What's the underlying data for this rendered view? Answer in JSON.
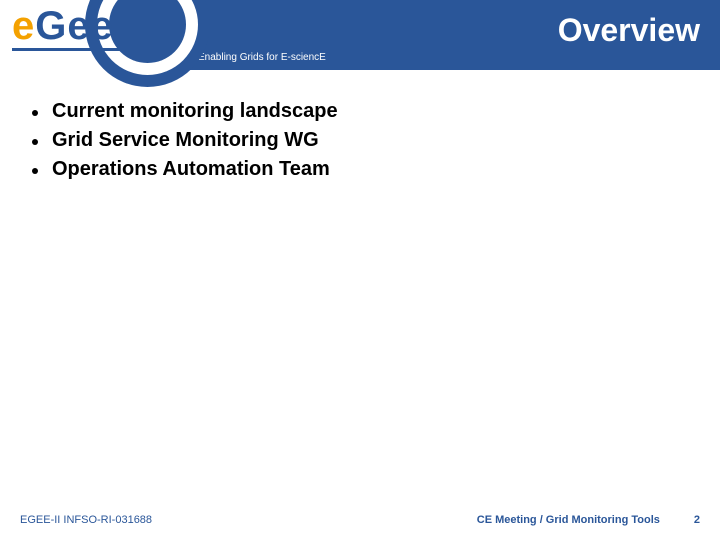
{
  "header": {
    "title": "Overview",
    "tagline": "Enabling Grids for E-sciencE"
  },
  "logo": {
    "char1": "e",
    "char2": "G",
    "char3": "e",
    "char4": "e"
  },
  "bullets": [
    {
      "text": "Current monitoring landscape"
    },
    {
      "text": "Grid Service Monitoring WG"
    },
    {
      "text": "Operations Automation Team"
    }
  ],
  "footer": {
    "left": "EGEE-II INFSO-RI-031688",
    "center": "CE Meeting / Grid Monitoring Tools",
    "pageNumber": "2"
  }
}
